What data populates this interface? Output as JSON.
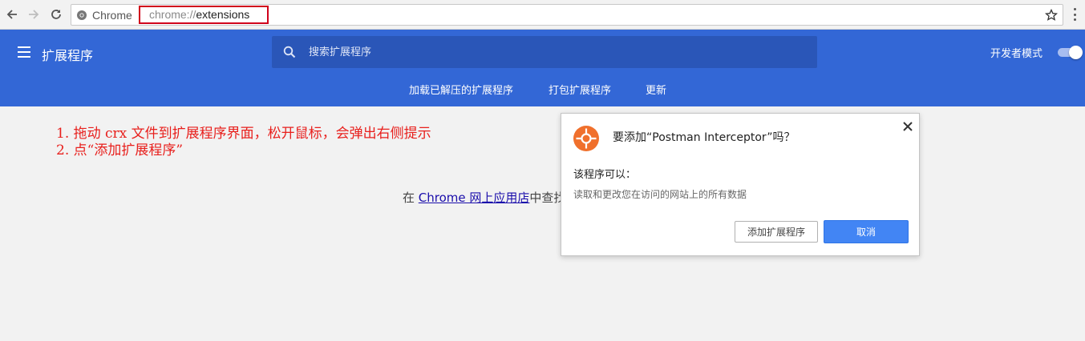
{
  "browser": {
    "back_icon": "arrow-left-icon",
    "forward_icon": "arrow-right-icon",
    "reload_icon": "reload-icon",
    "chip_label": "Chrome",
    "url_scheme": "chrome://",
    "url_path": "extensions",
    "bookmark_icon": "star-icon",
    "menu_icon": "kebab-menu-icon"
  },
  "header": {
    "title": "扩展程序",
    "search_placeholder": "搜索扩展程序",
    "dev_mode_label": "开发者模式",
    "dev_mode_on": true,
    "subnav": [
      "加载已解压的扩展程序",
      "打包扩展程序",
      "更新"
    ],
    "accent_color": "#3367d6"
  },
  "notes": [
    "1. 拖动 crx 文件到扩展程序界面，松开鼠标，会弹出右侧提示",
    "2. 点“添加扩展程序”"
  ],
  "store_line": {
    "prefix": "在 ",
    "link": "Chrome 网上应用店",
    "suffix": "中查找"
  },
  "dialog": {
    "title": "要添加“Postman Interceptor”吗？",
    "can_label": "该程序可以：",
    "permission": "读取和更改您在访问的网站上的所有数据",
    "add_button": "添加扩展程序",
    "cancel_button": "取消",
    "icon_color": "#f0702c"
  }
}
